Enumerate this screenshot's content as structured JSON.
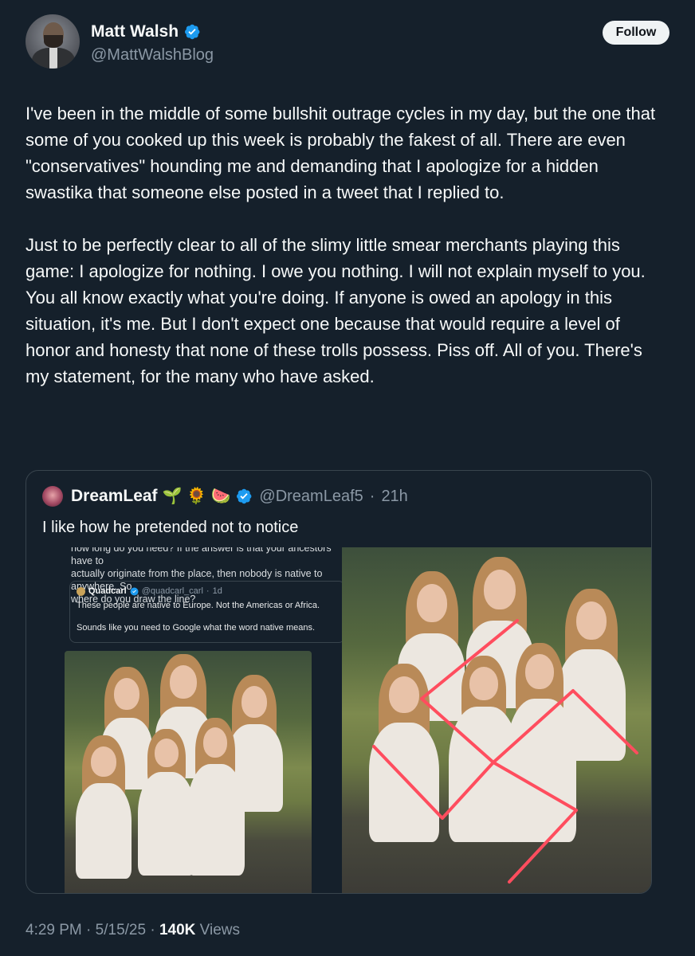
{
  "author": {
    "display_name": "Matt Walsh",
    "handle": "@MattWalshBlog",
    "verified": true
  },
  "actions": {
    "follow_label": "Follow"
  },
  "tweet": {
    "paragraphs": [
      "I've been in the middle of some bullshit outrage cycles in my day, but the one that some of you cooked up this week is probably the fakest of all. There are even \"conservatives\" hounding me and demanding that I apologize for a hidden swastika that someone else posted in a tweet that I replied to.",
      "Just to be perfectly clear to all of the slimy little smear merchants playing this game:  I apologize for nothing. I owe you nothing. I will not explain myself to you. You all know exactly what you're doing. If anyone is owed an apology in this situation, it's me. But I don't expect one because that would require a level of honor and honesty that none of these trolls possess. Piss off. All of you. There's my statement, for the many who have asked."
    ],
    "time": "4:29 PM",
    "date": "5/15/25",
    "views_count": "140K",
    "views_label": "Views",
    "separator": "·"
  },
  "quoted_tweet": {
    "display_name": "DreamLeaf",
    "emojis": "🌱 🌻 🍉",
    "handle": "@DreamLeaf5",
    "age": "21h",
    "text": "I like how he pretended not to notice",
    "media_left": {
      "text_lines": [
        "how long do you need? If the answer is that your ancestors have to",
        "actually originate from the place, then nobody is native to anywhere. So",
        "where do you draw the line?"
      ],
      "inner_quote": {
        "display_name": "Quadcarl",
        "handle": "@quadcarl_carl",
        "age": "1d",
        "line1": "These people are native to Europe. Not the Americas or Africa.",
        "line2": "Sounds like you need to Google what the word native means."
      }
    }
  },
  "colors": {
    "background": "#15202b",
    "text_primary": "#f7f9f9",
    "text_secondary": "#8b98a5",
    "border": "#38444d",
    "verified_blue": "#1d9bf0",
    "annotation_red": "#ff4d5e"
  }
}
